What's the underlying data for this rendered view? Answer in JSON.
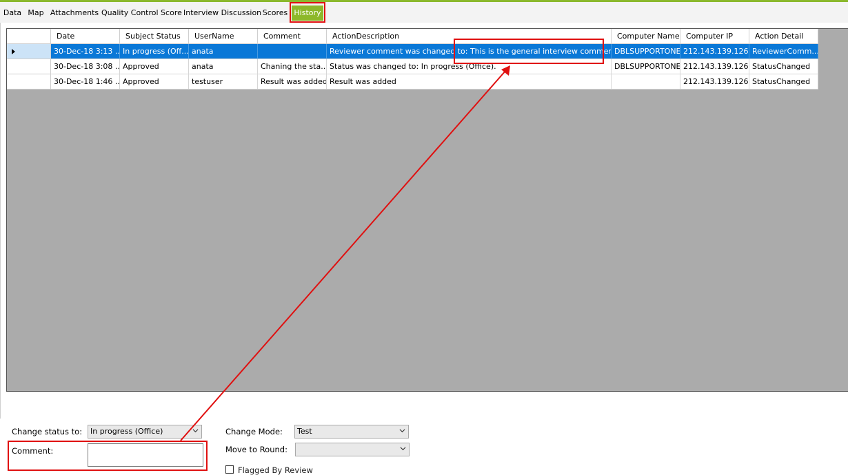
{
  "tabs": [
    {
      "label": "Data"
    },
    {
      "label": "Map"
    },
    {
      "label": "Attachments"
    },
    {
      "label": "Quality Control Score"
    },
    {
      "label": "Interview Discussion"
    },
    {
      "label": "Scores"
    },
    {
      "label": "History",
      "active": true
    }
  ],
  "grid": {
    "columns": [
      "Date",
      "Subject Status",
      "UserName",
      "Comment",
      "ActionDescription",
      "Computer Name",
      "Computer IP",
      "Action Detail"
    ],
    "rows": [
      {
        "date": "30-Dec-18 3:13 ...",
        "status": "In progress (Off...",
        "user": "anata",
        "comment": "",
        "action": "Reviewer comment was changed to: This is the general interview comment.",
        "computer": "DBLSUPPORTONE",
        "ip": "212.143.139.126",
        "detail": "ReviewerComm...",
        "selected": true
      },
      {
        "date": "30-Dec-18 3:08 ...",
        "status": "Approved",
        "user": "anata",
        "comment": "Chaning the sta...",
        "action": "Status was changed to: In progress (Office).",
        "computer": "DBLSUPPORTONE",
        "ip": "212.143.139.126",
        "detail": "StatusChanged"
      },
      {
        "date": "30-Dec-18 1:46 ...",
        "status": "Approved",
        "user": "testuser",
        "comment": "Result was added",
        "action": "Result was added",
        "computer": "",
        "ip": "212.143.139.126",
        "detail": "StatusChanged"
      }
    ]
  },
  "form": {
    "change_status_label": "Change status to:",
    "change_status_value": "In progress (Office)",
    "comment_label": "Comment:",
    "comment_value": "",
    "change_mode_label": "Change Mode:",
    "change_mode_value": "Test",
    "move_round_label": "Move to Round:",
    "move_round_value": "",
    "flagged_label": "Flagged By Review"
  },
  "colors": {
    "accent": "#8db82a",
    "selection": "#0a78d7",
    "annotation": "#e01010",
    "grid_background": "#ababab"
  }
}
